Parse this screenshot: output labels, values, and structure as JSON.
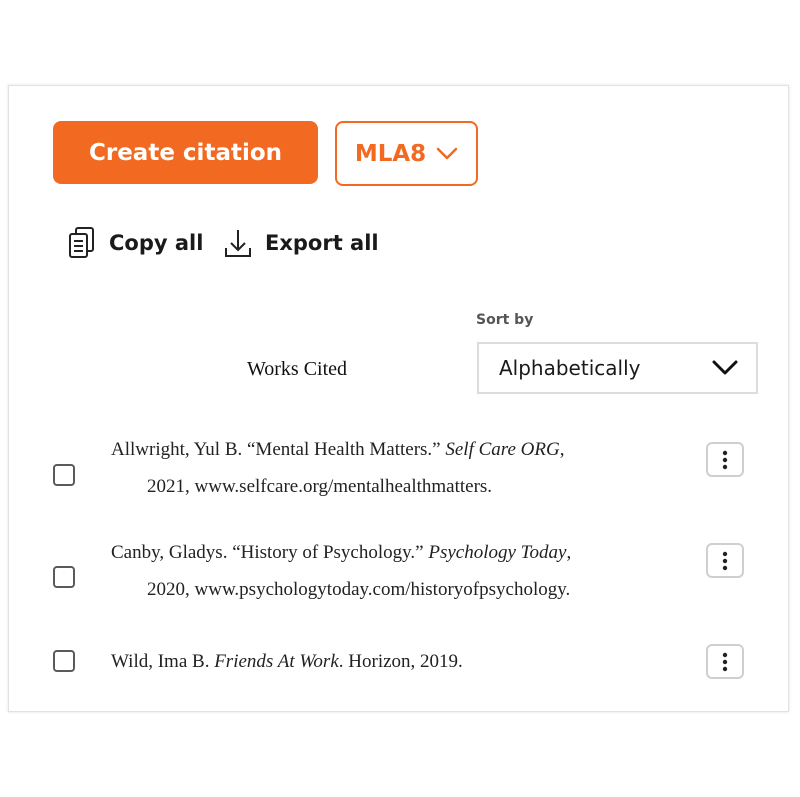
{
  "toolbar": {
    "create_label": "Create citation",
    "style_label": "MLA8",
    "copy_all_label": "Copy all",
    "export_all_label": "Export all"
  },
  "list": {
    "heading": "Works Cited",
    "sort_label": "Sort by",
    "sort_value": "Alphabetically"
  },
  "citations": [
    {
      "author": "Allwright, Yul B. ",
      "title": "“Mental Health Matters.” ",
      "container": "Self Care ORG",
      "rest1": ",",
      "line2": "2021, www.selfcare.org/mentalhealthmatters."
    },
    {
      "author": "Canby, Gladys. ",
      "title": "“History of Psychology.” ",
      "container": "Psychology Today",
      "rest1": ",",
      "line2": "2020, www.psychologytoday.com/historyofpsychology."
    },
    {
      "author": "Wild, Ima B. ",
      "title": "",
      "container": "Friends At Work",
      "rest1": ". Horizon, 2019.",
      "line2": ""
    }
  ],
  "colors": {
    "accent": "#f26a21",
    "border": "#dcdcdc"
  },
  "icons": {
    "copy": "copy-icon",
    "export": "download-icon",
    "chevron": "chevron-down-icon",
    "more": "more-vertical-icon"
  }
}
